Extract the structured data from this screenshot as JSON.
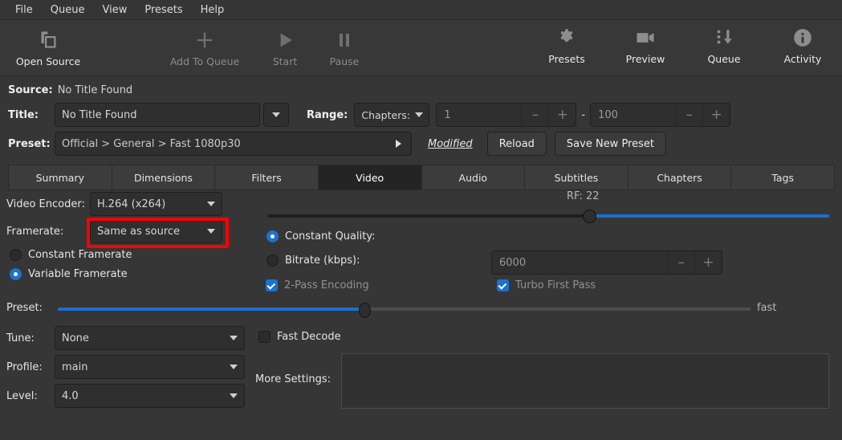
{
  "window": {
    "title": "HandBrake"
  },
  "menubar": {
    "items": [
      {
        "label": "File"
      },
      {
        "label": "Queue"
      },
      {
        "label": "View"
      },
      {
        "label": "Presets"
      },
      {
        "label": "Help"
      }
    ]
  },
  "toolbar": {
    "left": [
      {
        "label": "Open Source",
        "icon": "folder-open-icon",
        "enabled": true
      },
      {
        "label": "Add To Queue",
        "icon": "plus-icon",
        "enabled": false
      },
      {
        "label": "Start",
        "icon": "play-icon",
        "enabled": false
      },
      {
        "label": "Pause",
        "icon": "pause-icon",
        "enabled": false
      }
    ],
    "right": [
      {
        "label": "Presets",
        "icon": "gear-icon",
        "enabled": true
      },
      {
        "label": "Preview",
        "icon": "video-camera-icon",
        "enabled": true
      },
      {
        "label": "Queue",
        "icon": "queue-down-arrow-icon",
        "enabled": true
      },
      {
        "label": "Activity",
        "icon": "info-circle-icon",
        "enabled": true
      }
    ]
  },
  "source": {
    "label": "Source:",
    "value": "No Title Found"
  },
  "title_row": {
    "label": "Title:",
    "value": "No Title Found",
    "dropdown_icon": "chevron-down-icon",
    "range_label": "Range:",
    "range_mode": "Chapters:",
    "range_start": "1",
    "range_separator": "-",
    "range_end": "100",
    "minus": "–",
    "plus": "+"
  },
  "preset_row": {
    "label": "Preset:",
    "value": "Official > General > Fast 1080p30",
    "expand_icon": "chevron-right-icon",
    "modified_label": "Modified",
    "reload_label": "Reload",
    "save_label": "Save New Preset"
  },
  "tabs": [
    {
      "label": "Summary",
      "active": false
    },
    {
      "label": "Dimensions",
      "active": false
    },
    {
      "label": "Filters",
      "active": false
    },
    {
      "label": "Video",
      "active": true
    },
    {
      "label": "Audio",
      "active": false
    },
    {
      "label": "Subtitles",
      "active": false
    },
    {
      "label": "Chapters",
      "active": false
    },
    {
      "label": "Tags",
      "active": false
    }
  ],
  "video": {
    "encoder_label": "Video Encoder:",
    "encoder_value": "H.264 (x264)",
    "framerate_label": "Framerate:",
    "framerate_value": "Same as source",
    "framerate_highlight_color": "#fe0000",
    "constant_framerate_label": "Constant Framerate",
    "constant_framerate_selected": false,
    "variable_framerate_label": "Variable Framerate",
    "variable_framerate_selected": true,
    "rf_label": "RF: 22",
    "rf_value": 22,
    "quality_accent": "#1b6fd0",
    "constant_quality_label": "Constant Quality:",
    "constant_quality_selected": true,
    "bitrate_label": "Bitrate (kbps):",
    "bitrate_selected": false,
    "bitrate_value": "6000",
    "two_pass_label": "2-Pass Encoding",
    "two_pass_checked": true,
    "turbo_label": "Turbo First Pass",
    "turbo_checked": true,
    "preset_slider_label": "Preset:",
    "preset_slider_value_label": "fast",
    "tune_label": "Tune:",
    "tune_value": "None",
    "fast_decode_label": "Fast Decode",
    "fast_decode_checked": false,
    "profile_label": "Profile:",
    "profile_value": "main",
    "level_label": "Level:",
    "level_value": "4.0",
    "more_settings_label": "More Settings:",
    "more_settings_value": ""
  }
}
